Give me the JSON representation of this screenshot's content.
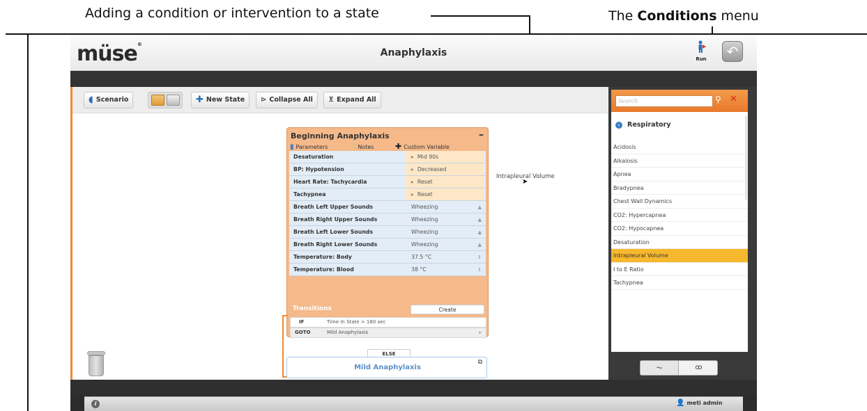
{
  "annotations": {
    "left_caption": "Adding a condition or intervention to a state",
    "right_caption_prefix": "The ",
    "right_caption_bold": "Conditions",
    "right_caption_suffix": " menu"
  },
  "app": {
    "logo": "müse",
    "logo_mark": "®",
    "title": "Anaphylaxis",
    "run_label": "Run",
    "run_icon": "run-person-icon",
    "undo_icon": "undo-arrow-icon"
  },
  "toolbar": {
    "scenario_label": "Scenario",
    "new_state_label": "New State",
    "collapse_all_label": "Collapse All",
    "expand_all_label": "Expand All"
  },
  "state": {
    "title": "Beginning Anaphylaxis",
    "collapse_symbol": "–",
    "tabs": {
      "parameters": "Parameters",
      "notes": "Notes",
      "custom_variable": "Custom Variable"
    },
    "parameters": [
      {
        "name": "Desaturation",
        "value": "Mid 90s",
        "highlight": true,
        "kind": "arrow"
      },
      {
        "name": "BP: Hypotension",
        "value": "Decreased",
        "highlight": true,
        "kind": "arrow"
      },
      {
        "name": "Heart Rate: Tachycardia",
        "value": "Reset",
        "highlight": true,
        "kind": "arrow"
      },
      {
        "name": "Tachypnea",
        "value": "Reset",
        "highlight": true,
        "kind": "arrow"
      },
      {
        "name": "Breath Left Upper Sounds",
        "value": "Wheezing",
        "highlight": false,
        "kind": "select"
      },
      {
        "name": "Breath Right Upper Sounds",
        "value": "Wheezing",
        "highlight": false,
        "kind": "select"
      },
      {
        "name": "Breath Left Lower Sounds",
        "value": "Wheezing",
        "highlight": false,
        "kind": "select"
      },
      {
        "name": "Breath Right Lower Sounds",
        "value": "Wheezing",
        "highlight": false,
        "kind": "select"
      },
      {
        "name": "Temperature: Body",
        "value": "37.5 °C",
        "highlight": false,
        "kind": "spin"
      },
      {
        "name": "Temperature: Blood",
        "value": "38 °C",
        "highlight": false,
        "kind": "spin"
      }
    ],
    "transitions_label": "Transitions",
    "create_label": "Create",
    "if_key": "IF",
    "if_value": "Time In State > 180 sec",
    "goto_key": "GOTO",
    "goto_value": "Mild Anaphylaxis",
    "else_label": "ELSE"
  },
  "next_state": {
    "title": "Mild Anaphylaxis"
  },
  "drag": {
    "label": "Intrapleural Volume"
  },
  "conditions_panel": {
    "search_placeholder": "Search",
    "category": "Respiratory",
    "items": [
      "Acidosis",
      "Alkalosis",
      "Apnea",
      "Bradypnea",
      "Chest Wall Dynamics",
      "CO2: Hypercapnea",
      "CO2: Hypocapnea",
      "Desaturation",
      "Intrapleural Volume",
      "I to E Ratio",
      "Tachypnea"
    ],
    "selected": "Intrapleural Volume"
  },
  "status": {
    "user": "meti admin"
  },
  "colors": {
    "accent_orange": "#ee8a30",
    "selected_item": "#f7b82e",
    "link_blue": "#5b8fc9"
  }
}
